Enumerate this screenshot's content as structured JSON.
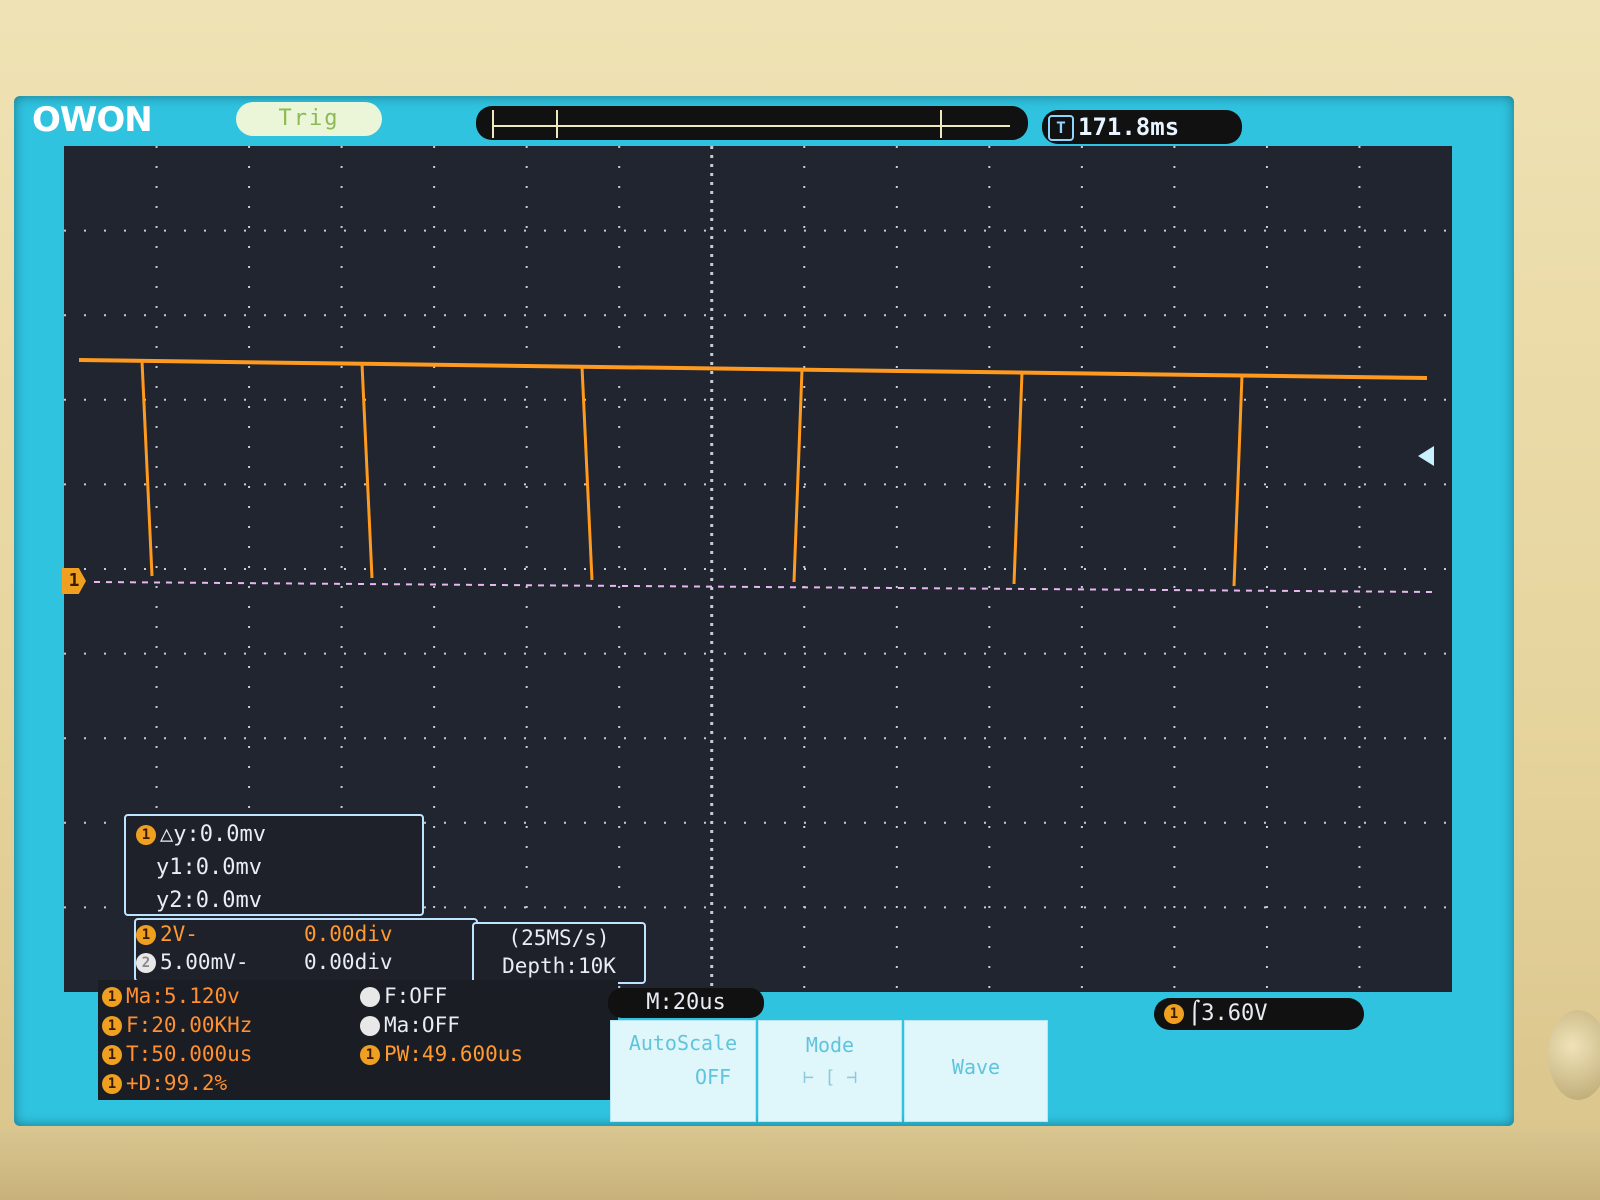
{
  "header": {
    "logo": "OWON",
    "trig_label": "Trig",
    "trigger_time": "171.8ms"
  },
  "waveform": {
    "channel_marker": "1",
    "pulse_count": 6
  },
  "cursor": {
    "dy": "△y:0.0mv",
    "y1": "y1:0.0mv",
    "y2": "y2:0.0mv"
  },
  "channels": [
    {
      "badge": "1",
      "scale": "2V-",
      "offset": "0.00div"
    },
    {
      "badge": "2",
      "scale": "5.00mV-",
      "offset": "0.00div"
    }
  ],
  "acquisition": {
    "sample_rate": "(25MS/s)",
    "depth": "Depth:10K"
  },
  "measurements": {
    "left": [
      {
        "badge": "1",
        "text": "Ma:5.120v"
      },
      {
        "badge": "1",
        "text": "F:20.00KHz"
      },
      {
        "badge": "1",
        "text": "T:50.000us"
      },
      {
        "badge": "1",
        "text": "+D:99.2%"
      }
    ],
    "right": [
      {
        "badge": "",
        "text": "F:OFF"
      },
      {
        "badge": "",
        "text": "Ma:OFF"
      },
      {
        "badge": "1",
        "text": "PW:49.600us"
      }
    ]
  },
  "timebase": "M:20us",
  "menu": {
    "autoscale": "AutoScale",
    "autoscale_state": "OFF",
    "mode": "Mode",
    "wave": "Wave"
  },
  "trigger": {
    "badge": "1",
    "level": "3.60V"
  },
  "colors": {
    "trace": "#ff9a1f",
    "screen_border": "#2fc3e0",
    "grid_dots": "#c8cbd4",
    "ground_line": "#e7b8ef"
  }
}
